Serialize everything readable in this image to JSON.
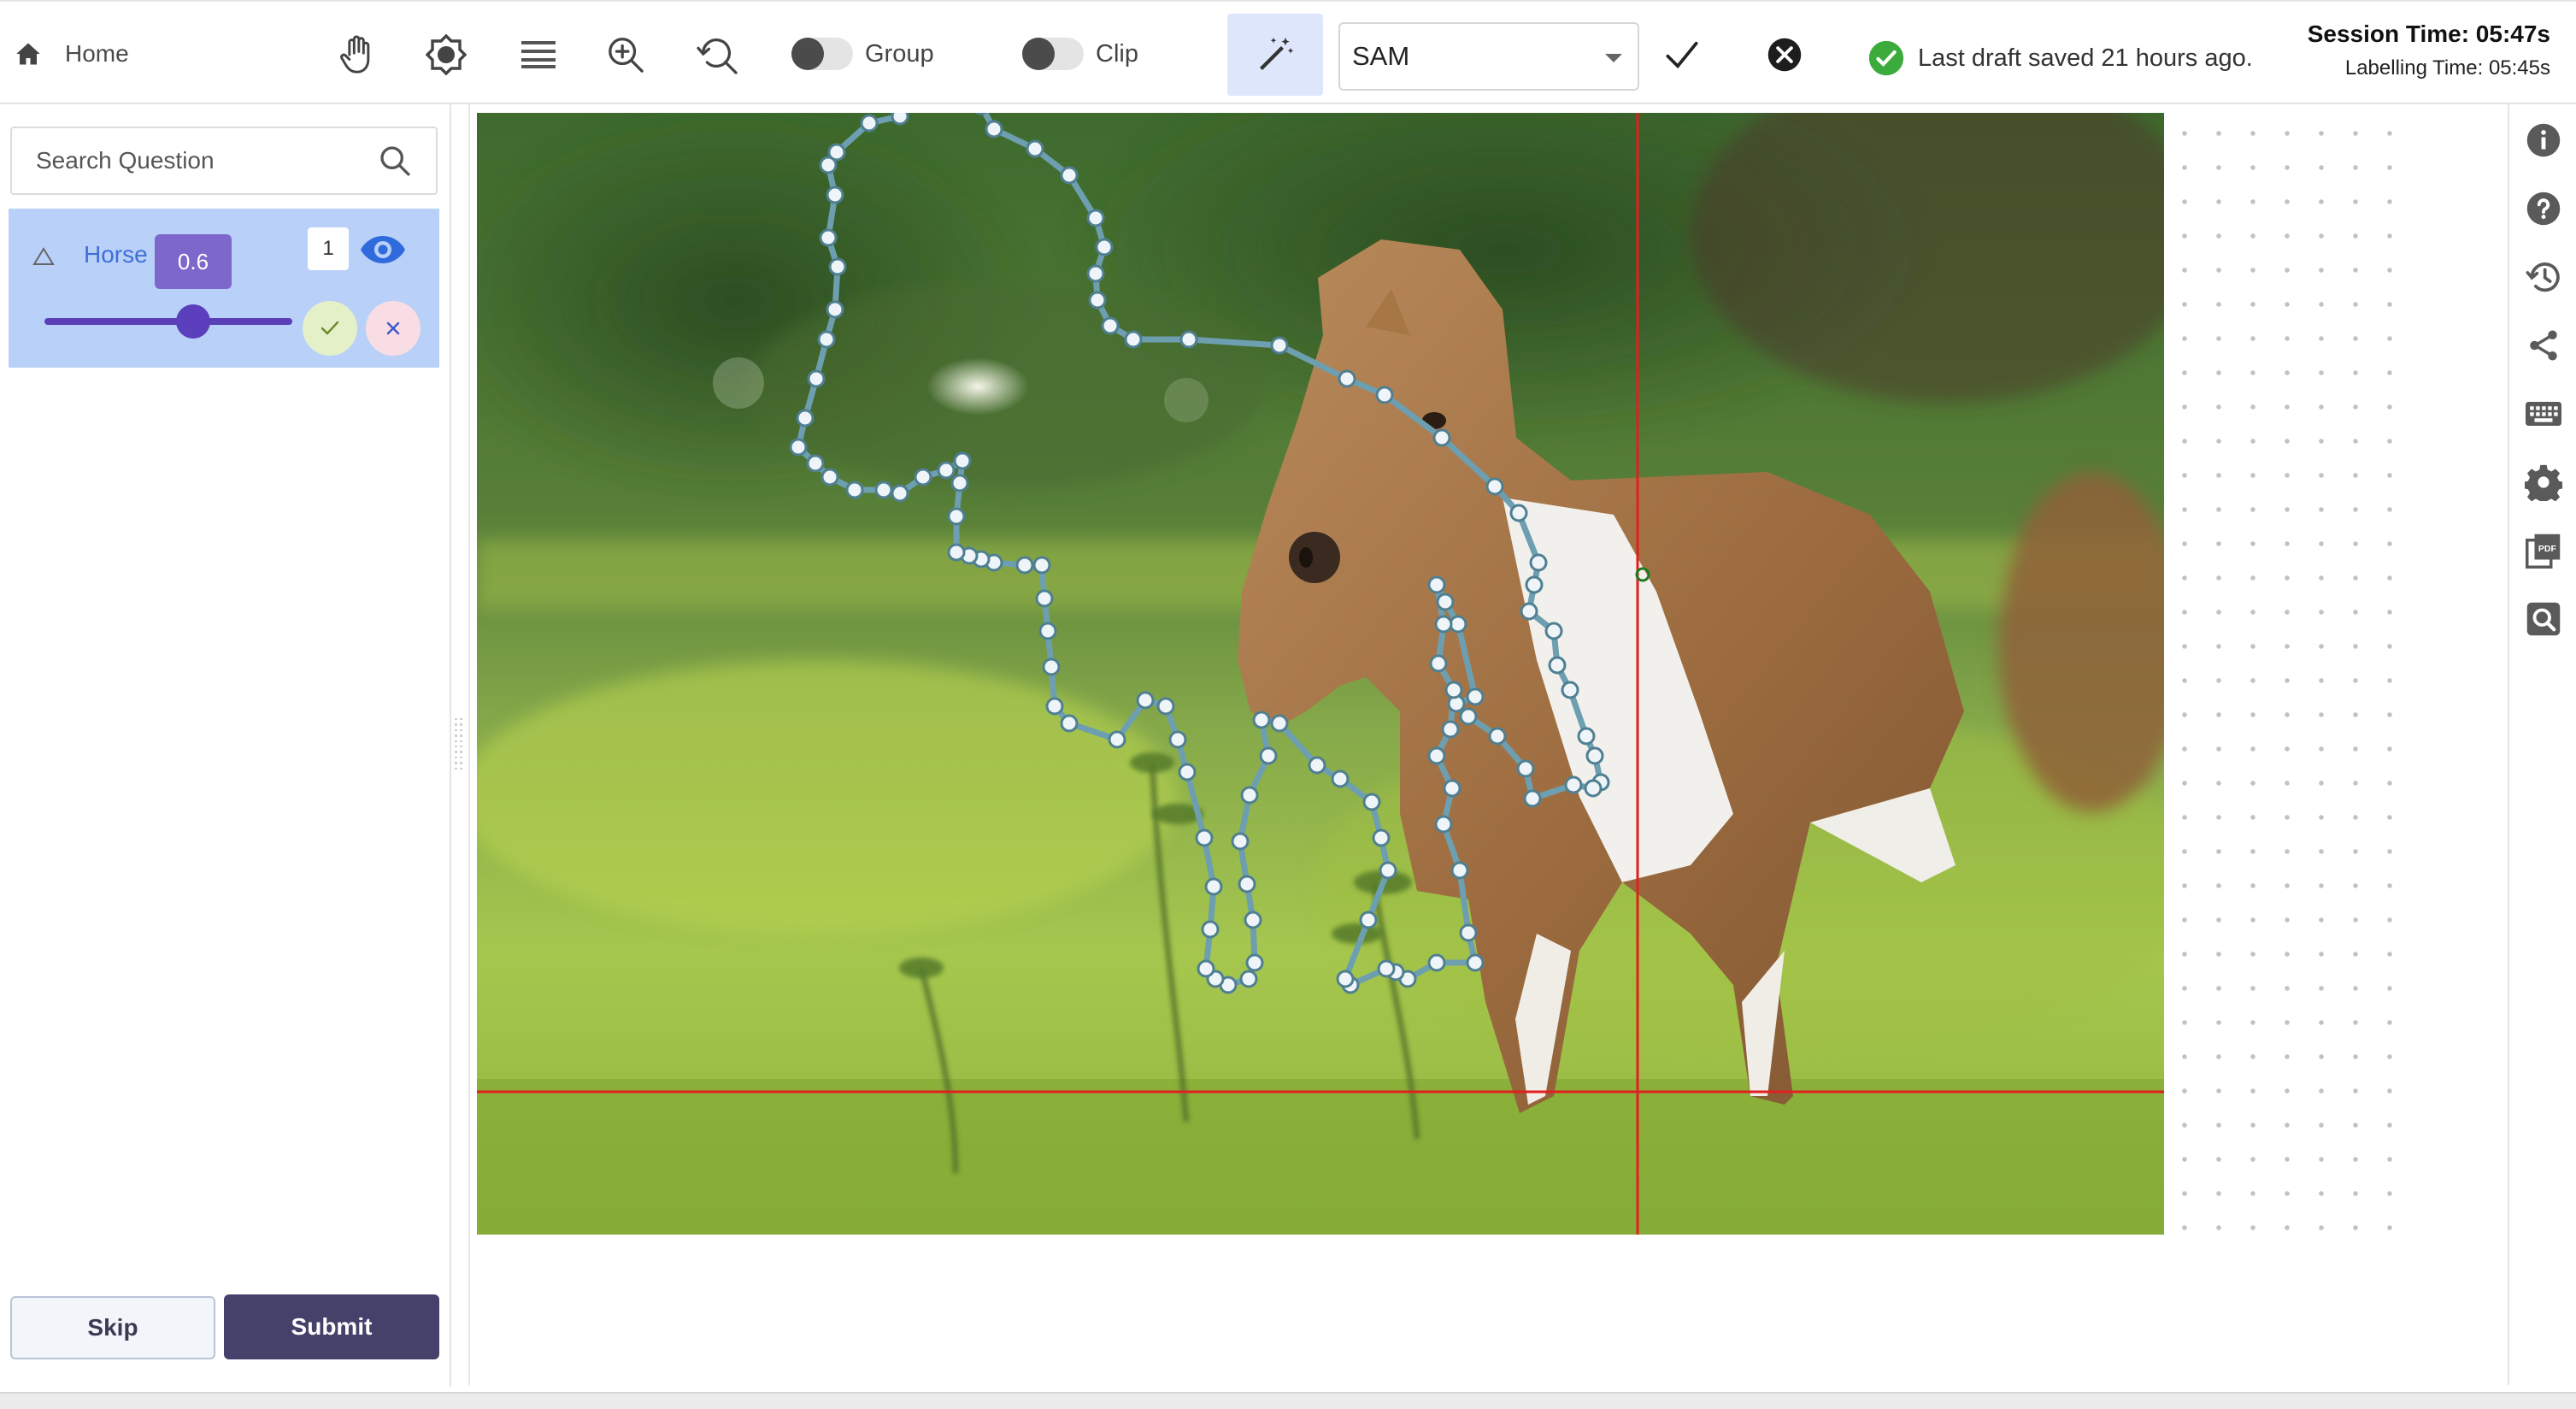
{
  "toolbar": {
    "home_label": "Home",
    "group_label": "Group",
    "clip_label": "Clip",
    "model_select_value": "SAM",
    "draft_status": "Last draft saved 21 hours ago.",
    "session_time": "Session Time: 05:47s",
    "labelling_time": "Labelling Time: 05:45s",
    "tools": [
      "hand-icon",
      "brightness-icon",
      "layers-icon",
      "zoom-in-icon",
      "zoom-reset-icon"
    ]
  },
  "sidebar": {
    "search_placeholder": "Search Question",
    "labels": [
      {
        "name": "Horse",
        "count": "1",
        "visible": true,
        "threshold": 0.6,
        "threshold_label": "0.6"
      }
    ],
    "skip_label": "Skip",
    "submit_label": "Submit"
  },
  "right_rail": {
    "icons": [
      "info-icon",
      "help-icon",
      "history-icon",
      "share-icon",
      "keyboard-icon",
      "settings-icon",
      "pdf-icon",
      "search-document-icon"
    ]
  },
  "colors": {
    "accent": "#5c3fbd",
    "selected_label_bg": "#b9d0f8",
    "submit_bg": "#45416a",
    "polygon_stroke": "#6d9fb0",
    "crosshair": "#e02020",
    "status_ok": "#3bab3b"
  }
}
